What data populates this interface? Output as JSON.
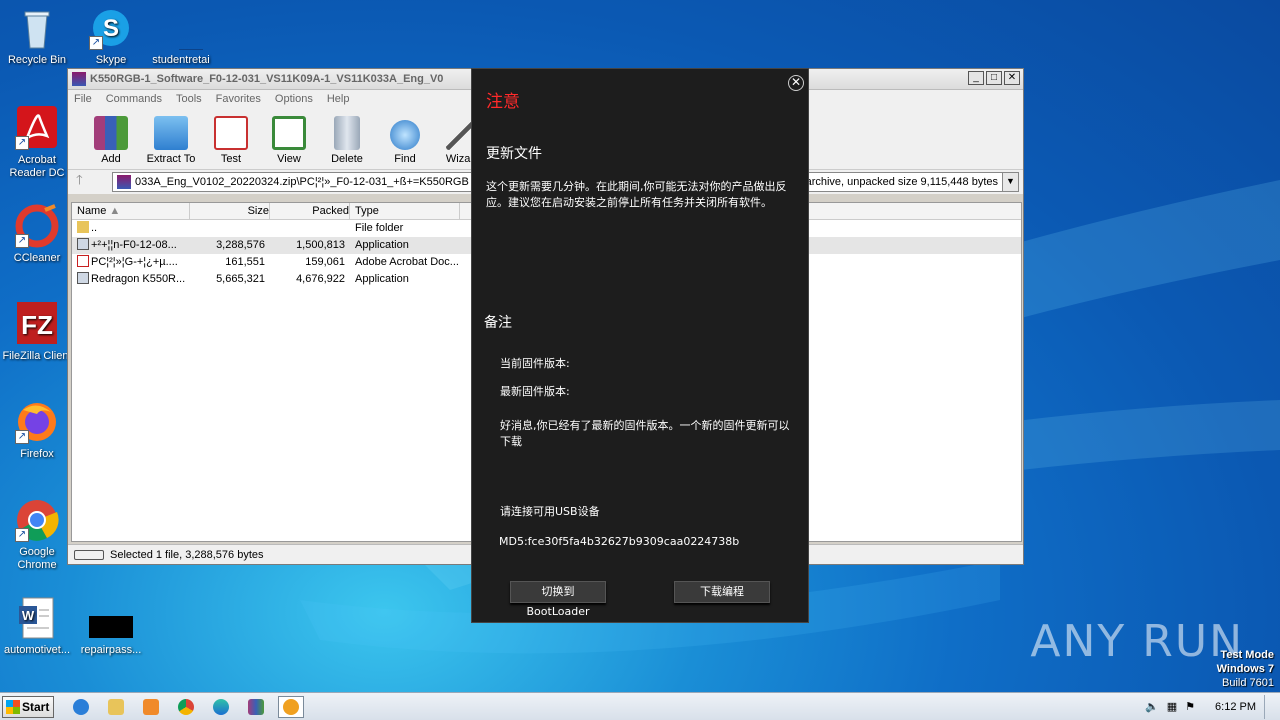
{
  "desktop": {
    "icons": [
      {
        "label": "Recycle Bin",
        "icon": "recycle-bin-icon"
      },
      {
        "label": "Skype",
        "icon": "skype-icon"
      },
      {
        "label": "studentretai",
        "icon": "folder-icon"
      },
      {
        "label": "Acrobat Reader DC",
        "icon": "acrobat-icon"
      },
      {
        "label": "CCleaner",
        "icon": "ccleaner-icon"
      },
      {
        "label": "FileZilla Client",
        "icon": "filezilla-icon"
      },
      {
        "label": "Firefox",
        "icon": "firefox-icon"
      },
      {
        "label": "Google Chrome",
        "icon": "chrome-icon"
      },
      {
        "label": "automotivet...",
        "icon": "word-doc-icon"
      },
      {
        "label": "repairpass...",
        "icon": "black-file-icon"
      }
    ]
  },
  "winrar": {
    "title": "K550RGB-1_Software_F0-12-031_VS11K09A-1_VS11K033A_Eng_V0",
    "menu": [
      "File",
      "Commands",
      "Tools",
      "Favorites",
      "Options",
      "Help"
    ],
    "toolbar": [
      "Add",
      "Extract To",
      "Test",
      "View",
      "Delete",
      "Find",
      "Wizard"
    ],
    "path": "033A_Eng_V0102_20220324.zip\\PC¦²¦»_F0-12-031_+ß+=K550RGB",
    "path_info": "archive, unpacked size 9,115,448 bytes",
    "columns": [
      "Name",
      "Size",
      "Packed",
      "Type"
    ],
    "files": [
      {
        "name": "..",
        "size": "",
        "packed": "",
        "type": "File folder"
      },
      {
        "name": "+²+¦¦n-F0-12-08...",
        "size": "3,288,576",
        "packed": "1,500,813",
        "type": "Application"
      },
      {
        "name": "PC¦²¦»¦G-+¦¿+µ....",
        "size": "161,551",
        "packed": "159,061",
        "type": "Adobe Acrobat Doc..."
      },
      {
        "name": "Redragon K550R...",
        "size": "5,665,321",
        "packed": "4,676,922",
        "type": "Application"
      }
    ],
    "status": "Selected 1 file, 3,288,576 bytes"
  },
  "dialog": {
    "close": "✕",
    "title": "注意",
    "section1": "更新文件",
    "warning": "这个更新需要几分钟。在此期间,你可能无法对你的产品做出反应。建议您在启动安装之前停止所有任务并关闭所有软件。",
    "section2": "备注",
    "current_fw": "当前固件版本:",
    "latest_fw": "最新固件版本:",
    "good_news": "好消息,你已经有了最新的固件版本。一个新的固件更新可以下载",
    "connect": "请连接可用USB设备",
    "md5": "MD5:fce30f5fa4b32627b9309caa0224738b",
    "btn_bootloader": "切换到BootLoader",
    "btn_download": "下载编程"
  },
  "taskbar": {
    "start": "Start",
    "time": "6:12 PM"
  },
  "watermark": "ANY RUN",
  "testmode": {
    "line1": "Test Mode",
    "line2": "Windows 7",
    "line3": "Build 7601"
  }
}
